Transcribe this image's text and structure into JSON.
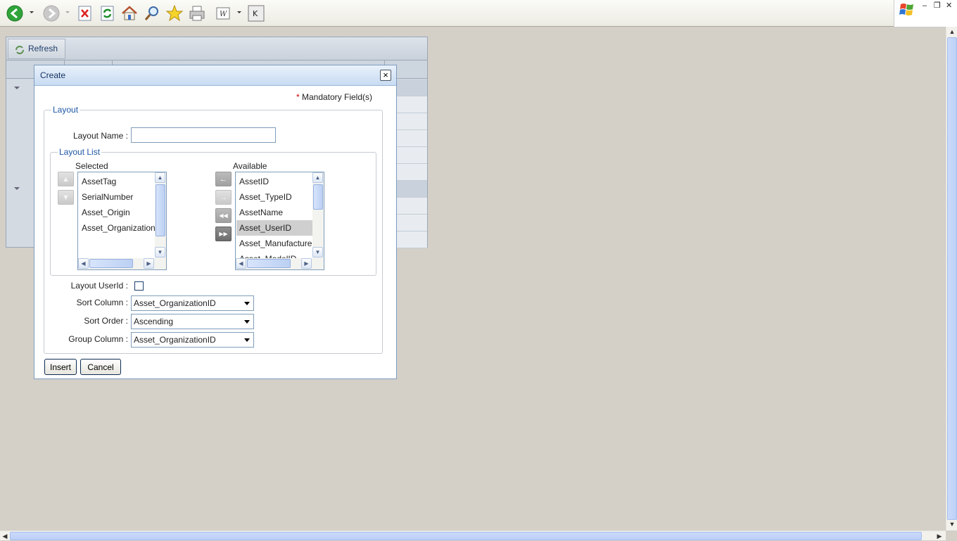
{
  "toolbar": {
    "buttons": [
      "back-icon",
      "forward-icon",
      "stop-icon",
      "refresh-icon",
      "home-icon",
      "search-icon",
      "favorites-icon",
      "print-icon",
      "word-icon",
      "k-icon"
    ]
  },
  "background_grid": {
    "refresh_label": "Refresh"
  },
  "dialog": {
    "title": "Create",
    "mandatory_star": "*",
    "mandatory_text": "Mandatory Field(s)",
    "layout_legend": "Layout",
    "layout_name_label": "Layout Name :",
    "layout_name_value": "",
    "layout_list_legend": "Layout List",
    "selected_label": "Selected",
    "available_label": "Available",
    "selected_items": [
      "AssetTag",
      "SerialNumber",
      "Asset_Origin",
      "Asset_OrganizationID"
    ],
    "available_items": [
      "AssetID",
      "Asset_TypeID",
      "AssetName",
      "Asset_UserID",
      "Asset_ManufacturerID",
      "Asset_ModelID"
    ],
    "available_selected": "Asset_UserID",
    "move_buttons": {
      "up": "▲",
      "down": "▼",
      "move_left": "←",
      "move_right": "→",
      "move_all_left": "◀◀",
      "move_all_right": "▶▶"
    },
    "layout_userid_label": "Layout UserId :",
    "layout_userid_checked": false,
    "sort_column_label": "Sort Column :",
    "sort_column_value": "Asset_OrganizationID",
    "sort_order_label": "Sort Order :",
    "sort_order_value": "Ascending",
    "group_column_label": "Group Column :",
    "group_column_value": "Asset_OrganizationID",
    "insert_label": "Insert",
    "cancel_label": "Cancel",
    "close_glyph": "×"
  },
  "colors": {
    "legend": "#1f57a5",
    "title_bar": "#c8dcf2",
    "page_bg": "#d4d0c8"
  }
}
